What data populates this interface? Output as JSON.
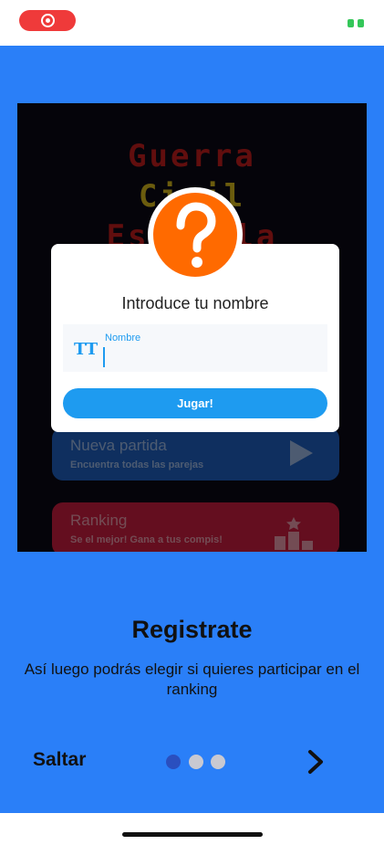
{
  "colors": {
    "background_blue": "#2a7ff8",
    "accent": "#1e9bf0",
    "question_badge": "#ff6a00",
    "record_pill": "#ef3a3a"
  },
  "game_screen": {
    "title_lines": [
      "Guerra",
      "Civil",
      "Española"
    ],
    "menu": [
      {
        "title": "Nueva partida",
        "subtitle": "Encuentra todas las parejas",
        "icon": "play-icon"
      },
      {
        "title": "Ranking",
        "subtitle": "Se el mejor! Gana a tus compis!",
        "icon": "podium-icon"
      }
    ]
  },
  "dialog": {
    "icon": "question-mark-icon",
    "title": "Introduce tu nombre",
    "field_icon": "text-format-icon",
    "field_icon_text": "TT",
    "field_label": "Nombre",
    "field_value": "",
    "button_label": "Jugar!"
  },
  "onboarding": {
    "heading": "Registrate",
    "description_line1": "Así luego podrás elegir si quieres participar en el",
    "description_line2": "ranking",
    "skip_label": "Saltar",
    "page_count": 3,
    "current_page": 1,
    "next_icon": "chevron-right-icon"
  }
}
